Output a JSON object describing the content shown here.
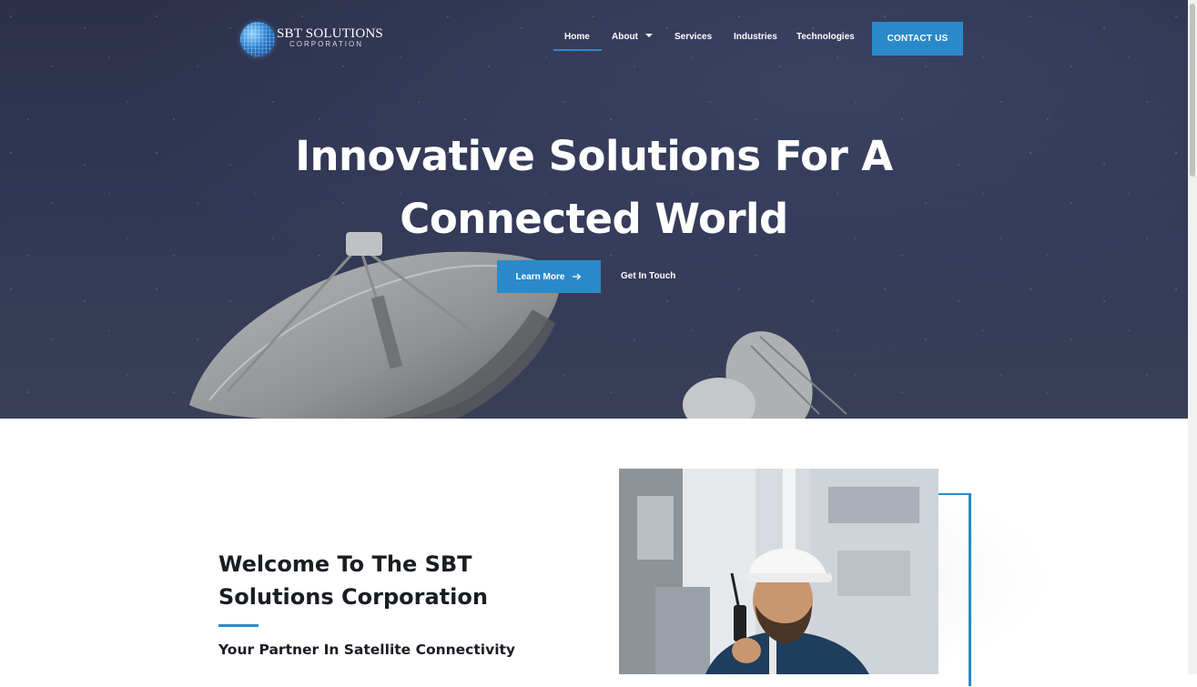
{
  "brand": {
    "name": "SBT SOLUTIONS",
    "sub": "CORPORATION",
    "accent": "#2a8ac9"
  },
  "nav": {
    "items": [
      {
        "label": "Home",
        "active": true
      },
      {
        "label": "About",
        "has_dropdown": true
      },
      {
        "label": "Services"
      },
      {
        "label": "Industries"
      },
      {
        "label": "Technologies"
      }
    ],
    "contact_label": "CONTACT US"
  },
  "hero": {
    "title_line1": "Innovative Solutions For A",
    "title_line2": "Connected World",
    "primary_button": "Learn More",
    "primary_icon": "arrow-right-icon",
    "secondary_link": "Get In Touch"
  },
  "welcome": {
    "title_line1": "Welcome To The SBT",
    "title_line2": "Solutions Corporation",
    "subtitle": "Your Partner In Satellite Connectivity"
  }
}
